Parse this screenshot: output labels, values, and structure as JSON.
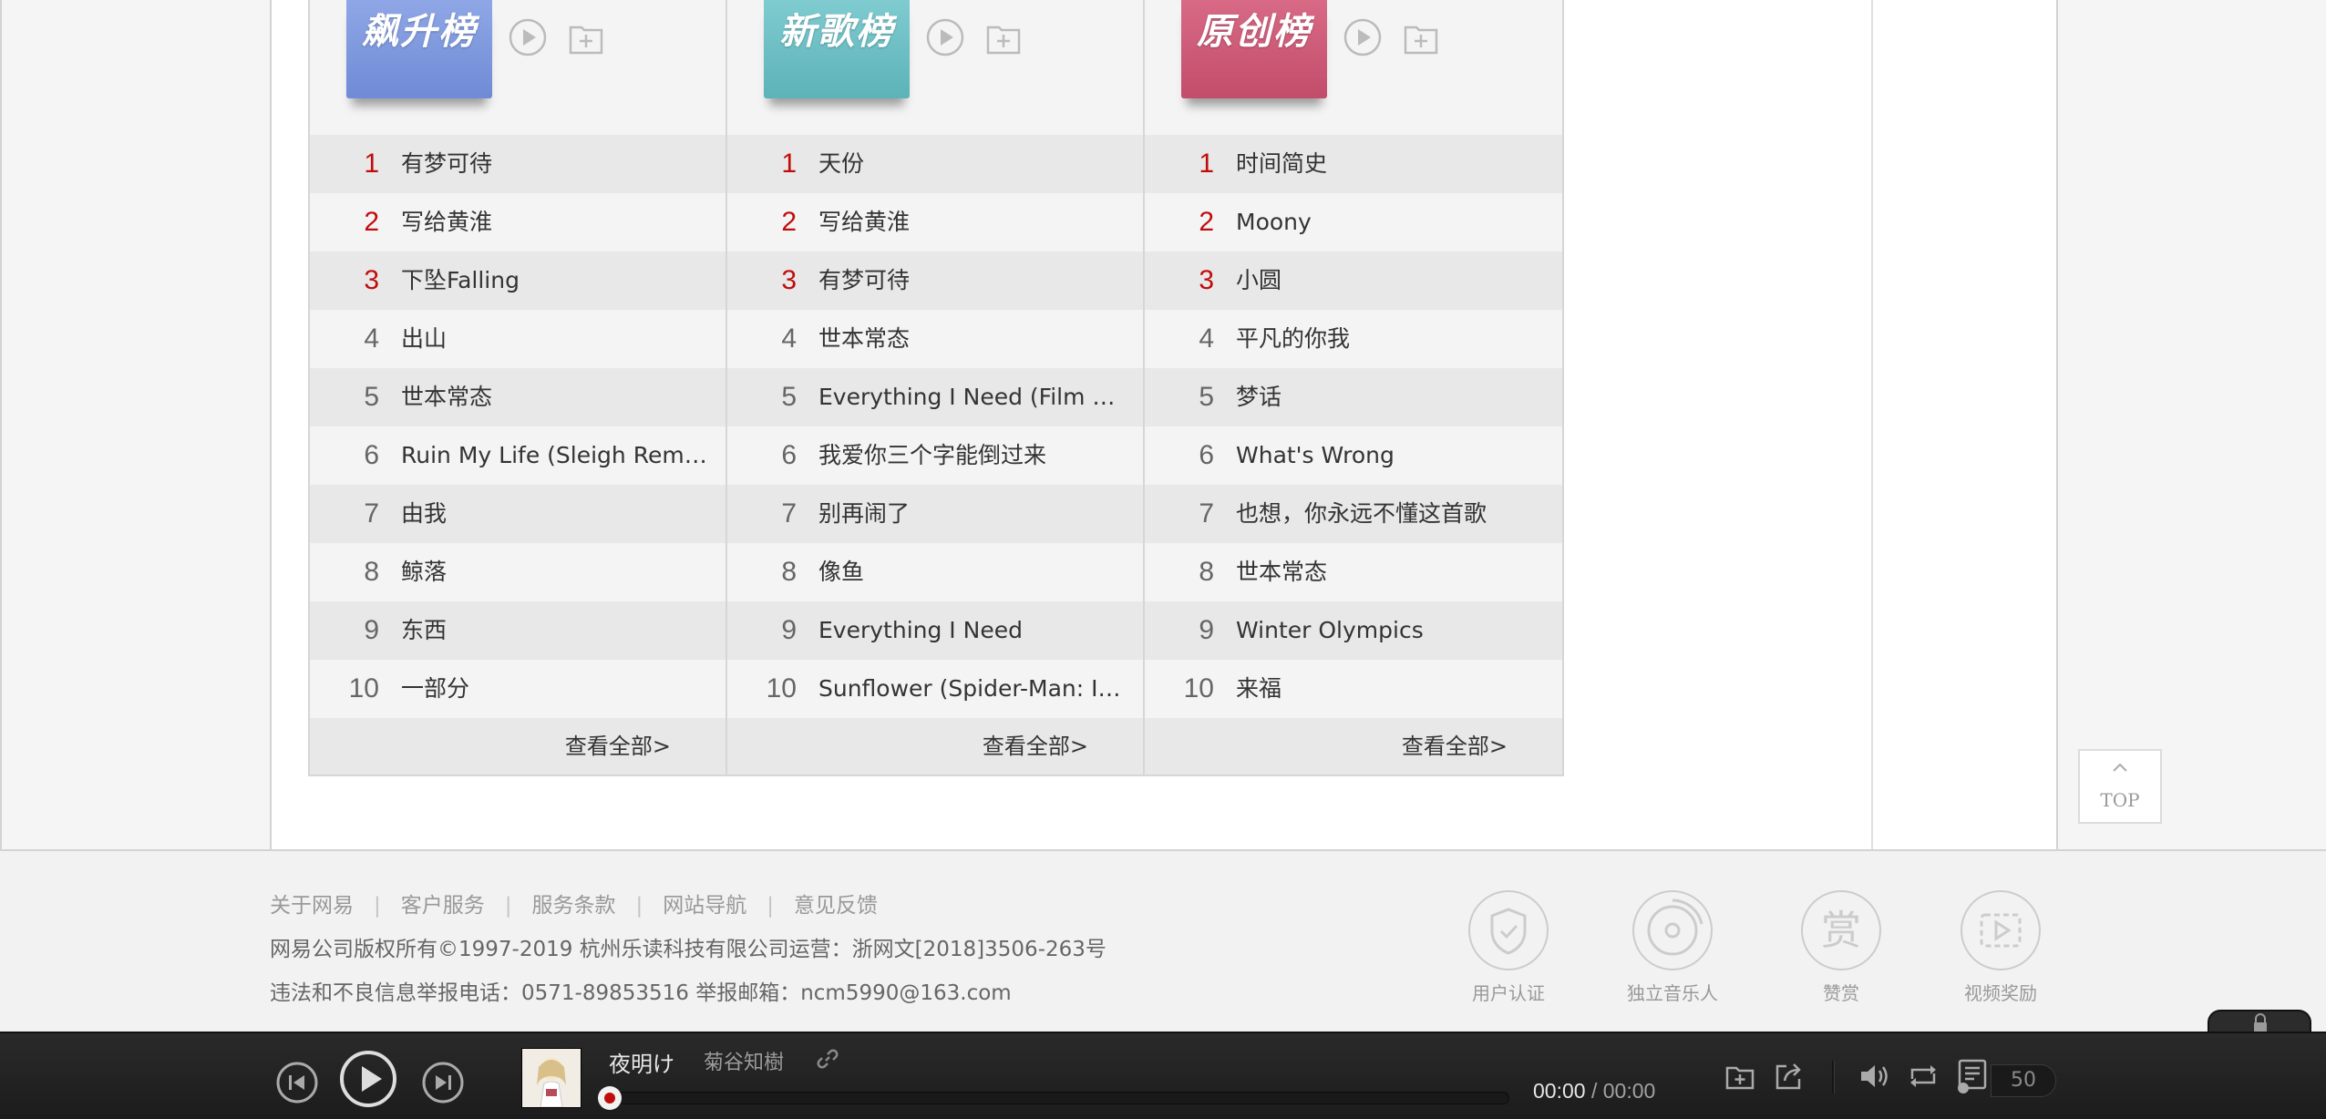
{
  "charts": [
    {
      "cover_title": "飙升榜",
      "cover_color_top": "#8fa7e6",
      "cover_color_bottom": "#6f8bd6",
      "songs": [
        "有梦可待",
        "写给黄淮",
        "下坠Falling",
        "出山",
        "世本常态",
        "Ruin My Life (Sleigh Remix)",
        "由我",
        "鲸落",
        "东西",
        "一部分"
      ]
    },
    {
      "cover_title": "新歌榜",
      "cover_color_top": "#7fcbd0",
      "cover_color_bottom": "#5cb3b8",
      "songs": [
        "天份",
        "写给黄淮",
        "有梦可待",
        "世本常态",
        "Everything I Need (Film Version)",
        "我爱你三个字能倒过来",
        "别再闹了",
        "像鱼",
        "Everything I Need",
        "Sunflower (Spider-Man: Into the Spider-Verse)"
      ]
    },
    {
      "cover_title": "原创榜",
      "cover_color_top": "#d86a86",
      "cover_color_bottom": "#c24d6a",
      "songs": [
        "时间简史",
        "Moony",
        "小圆",
        "平凡的你我",
        "梦话",
        "What's Wrong",
        "也想，你永远不懂这首歌",
        "世本常态",
        "Winter Olympics",
        "来福"
      ]
    }
  ],
  "ranks": [
    "1",
    "2",
    "3",
    "4",
    "5",
    "6",
    "7",
    "8",
    "9",
    "10"
  ],
  "view_all_label": "查看全部>",
  "top_button_label": "TOP",
  "footer": {
    "links": [
      "关于网易",
      "客户服务",
      "服务条款",
      "网站导航",
      "意见反馈"
    ],
    "separator": "|",
    "copyright": "网易公司版权所有©1997-2019   杭州乐读科技有限公司运营：浙网文[2018]3506-263号",
    "report": "违法和不良信息举报电话：0571-89853516    举报邮箱：ncm5990@163.com",
    "badges": [
      "用户认证",
      "独立音乐人",
      "赞赏",
      "视频奖励"
    ]
  },
  "player": {
    "song_title": "夜明け",
    "artist": "菊谷知樹",
    "current_time": "00:00",
    "time_separator": " / ",
    "total_time": "00:00",
    "playlist_count": "50"
  },
  "colors": {
    "rank_highlight": "#c20c0c",
    "accent": "#c20c0c"
  }
}
